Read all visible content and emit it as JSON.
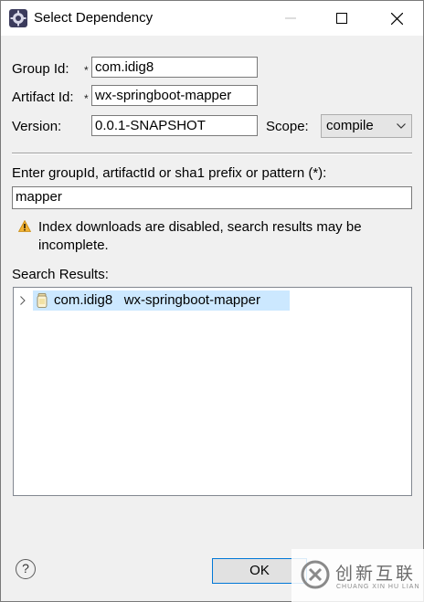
{
  "window": {
    "title": "Select Dependency",
    "app_icon": "eclipse-gear-icon"
  },
  "form": {
    "group_id_label": "Group Id:",
    "group_id_value": "com.idig8",
    "artifact_id_label": "Artifact Id:",
    "artifact_id_value": "wx-springboot-mapper",
    "version_label": "Version:",
    "version_value": "0.0.1-SNAPSHOT",
    "scope_label": "Scope:",
    "scope_value": "compile",
    "required_marker": "*"
  },
  "search": {
    "prompt": "Enter groupId, artifactId or sha1 prefix or pattern (*):",
    "value": "mapper",
    "warning": "Index downloads are disabled, search results may be incomplete.",
    "results_label": "Search Results:",
    "results": [
      {
        "group": "com.idig8",
        "artifact": "wx-springboot-mapper",
        "icon": "jar-icon",
        "selected": true
      }
    ]
  },
  "buttons": {
    "help": "?",
    "ok": "OK"
  },
  "watermark": {
    "text": "创新互联",
    "sub": "CHUANG XIN HU LIAN"
  },
  "colors": {
    "selection": "#cce8ff",
    "focus_border": "#0078d7",
    "warning": "#f2b233"
  }
}
